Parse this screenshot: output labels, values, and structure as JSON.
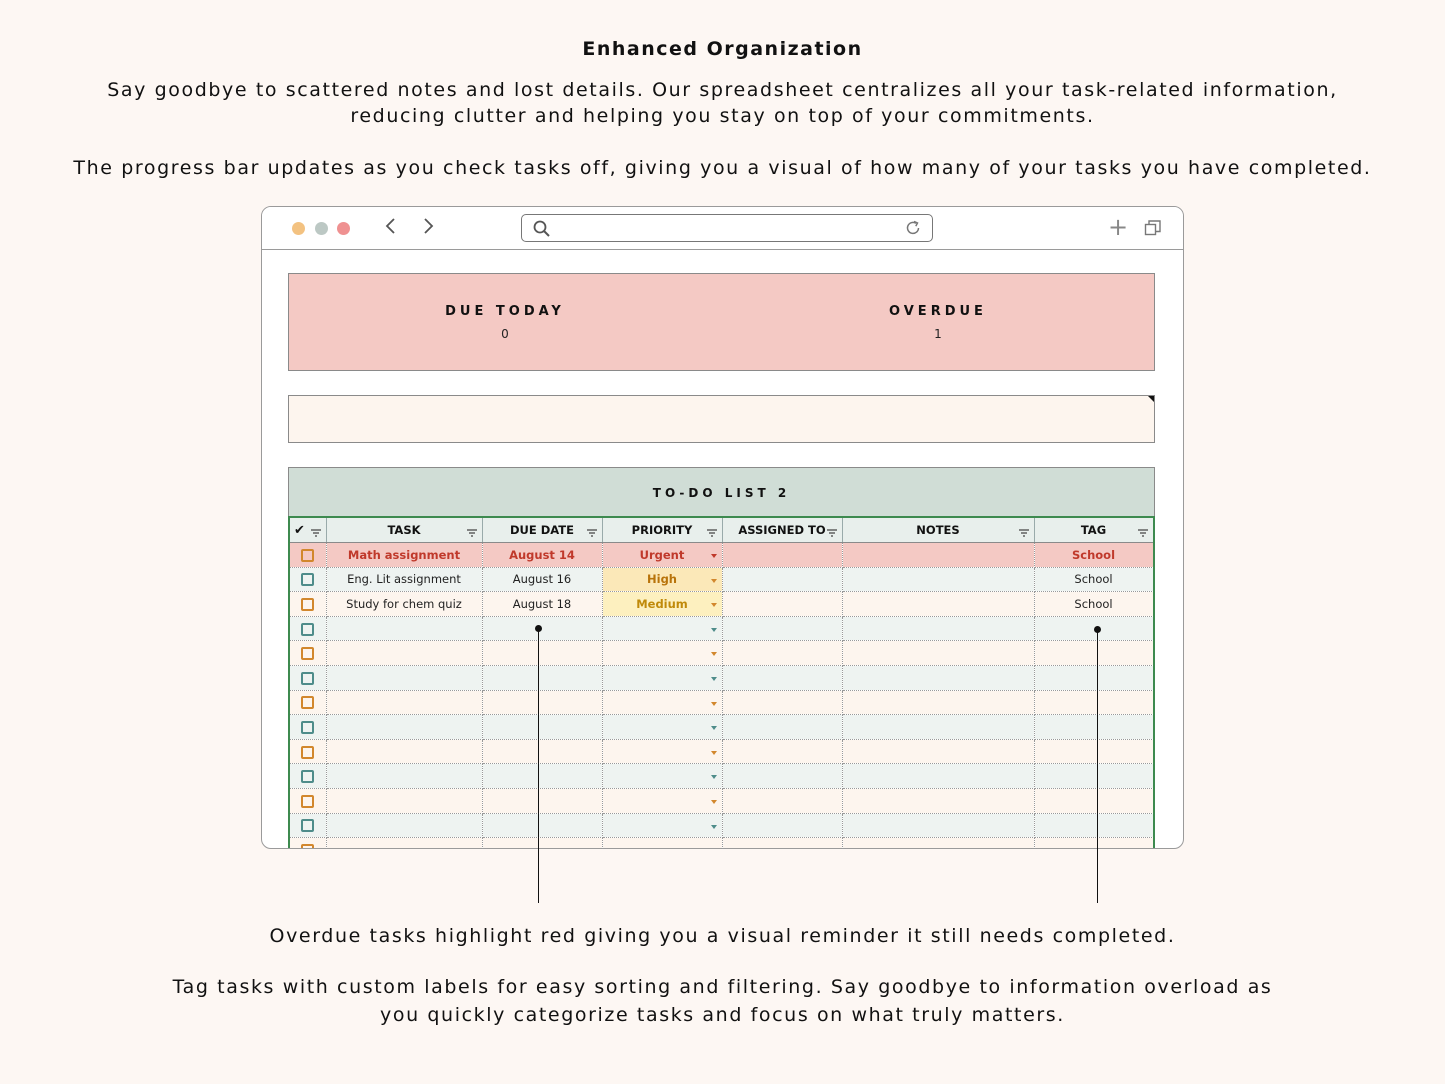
{
  "heading": "Enhanced Organization",
  "intro_paragraph": "Say goodbye to scattered notes and lost details. Our spreadsheet centralizes all your task-related information, reducing clutter and helping you stay on top of your commitments.",
  "progress_paragraph": "The progress bar updates as you check tasks off, giving you a visual of how many of your tasks you have completed.",
  "overdue_caption": "Overdue tasks highlight red giving you a visual reminder it still needs completed.",
  "tag_caption": "Tag tasks with custom labels for easy sorting and filtering. Say goodbye to information overload as you quickly categorize tasks and focus on what truly matters.",
  "browser": {
    "icons": {
      "back": "chevron-left-icon",
      "forward": "chevron-right-icon",
      "search": "search-icon",
      "reload": "reload-icon",
      "new_tab": "plus-icon",
      "tabs": "copy-icon"
    },
    "address_value": ""
  },
  "summary": {
    "due_today_label": "DUE TODAY",
    "due_today_value": "0",
    "overdue_label": "OVERDUE",
    "overdue_value": "1"
  },
  "progress": {
    "completed_fraction": 0
  },
  "list": {
    "title": "TO-DO LIST 2",
    "columns": [
      {
        "key": "check",
        "label": "✔"
      },
      {
        "key": "task",
        "label": "TASK"
      },
      {
        "key": "due",
        "label": "DUE DATE"
      },
      {
        "key": "priority",
        "label": "PRIORITY"
      },
      {
        "key": "assigned",
        "label": "ASSIGNED TO"
      },
      {
        "key": "notes",
        "label": "NOTES"
      },
      {
        "key": "tag",
        "label": "TAG"
      }
    ],
    "rows": [
      {
        "checked": false,
        "task": "Math assignment",
        "due": "August 14",
        "priority": "Urgent",
        "assigned": "",
        "notes": "",
        "tag": "School",
        "overdue": true
      },
      {
        "checked": false,
        "task": "Eng. Lit assignment",
        "due": "August 16",
        "priority": "High",
        "assigned": "",
        "notes": "",
        "tag": "School",
        "overdue": false
      },
      {
        "checked": false,
        "task": "Study for chem quiz",
        "due": "August 18",
        "priority": "Medium",
        "assigned": "",
        "notes": "",
        "tag": "School",
        "overdue": false
      },
      {
        "checked": false,
        "task": "",
        "due": "",
        "priority": "",
        "assigned": "",
        "notes": "",
        "tag": "",
        "overdue": false
      },
      {
        "checked": false,
        "task": "",
        "due": "",
        "priority": "",
        "assigned": "",
        "notes": "",
        "tag": "",
        "overdue": false
      },
      {
        "checked": false,
        "task": "",
        "due": "",
        "priority": "",
        "assigned": "",
        "notes": "",
        "tag": "",
        "overdue": false
      },
      {
        "checked": false,
        "task": "",
        "due": "",
        "priority": "",
        "assigned": "",
        "notes": "",
        "tag": "",
        "overdue": false
      },
      {
        "checked": false,
        "task": "",
        "due": "",
        "priority": "",
        "assigned": "",
        "notes": "",
        "tag": "",
        "overdue": false
      },
      {
        "checked": false,
        "task": "",
        "due": "",
        "priority": "",
        "assigned": "",
        "notes": "",
        "tag": "",
        "overdue": false
      },
      {
        "checked": false,
        "task": "",
        "due": "",
        "priority": "",
        "assigned": "",
        "notes": "",
        "tag": "",
        "overdue": false
      },
      {
        "checked": false,
        "task": "",
        "due": "",
        "priority": "",
        "assigned": "",
        "notes": "",
        "tag": "",
        "overdue": false
      },
      {
        "checked": false,
        "task": "",
        "due": "",
        "priority": "",
        "assigned": "",
        "notes": "",
        "tag": "",
        "overdue": false
      },
      {
        "checked": false,
        "task": "",
        "due": "",
        "priority": "",
        "assigned": "",
        "notes": "",
        "tag": "",
        "overdue": false
      },
      {
        "checked": false,
        "task": "",
        "due": "",
        "priority": "",
        "assigned": "",
        "notes": "",
        "tag": "",
        "overdue": false
      }
    ]
  },
  "colors": {
    "background": "#fdf7f3",
    "summary_bg": "#f4c9c4",
    "list_header_bg": "#d0ddd6",
    "overdue_text": "#c0392b",
    "high_text": "#b8730a",
    "checkbox_orange": "#d2872d",
    "checkbox_teal": "#4e8c8a",
    "table_border": "#3d8a4f"
  }
}
